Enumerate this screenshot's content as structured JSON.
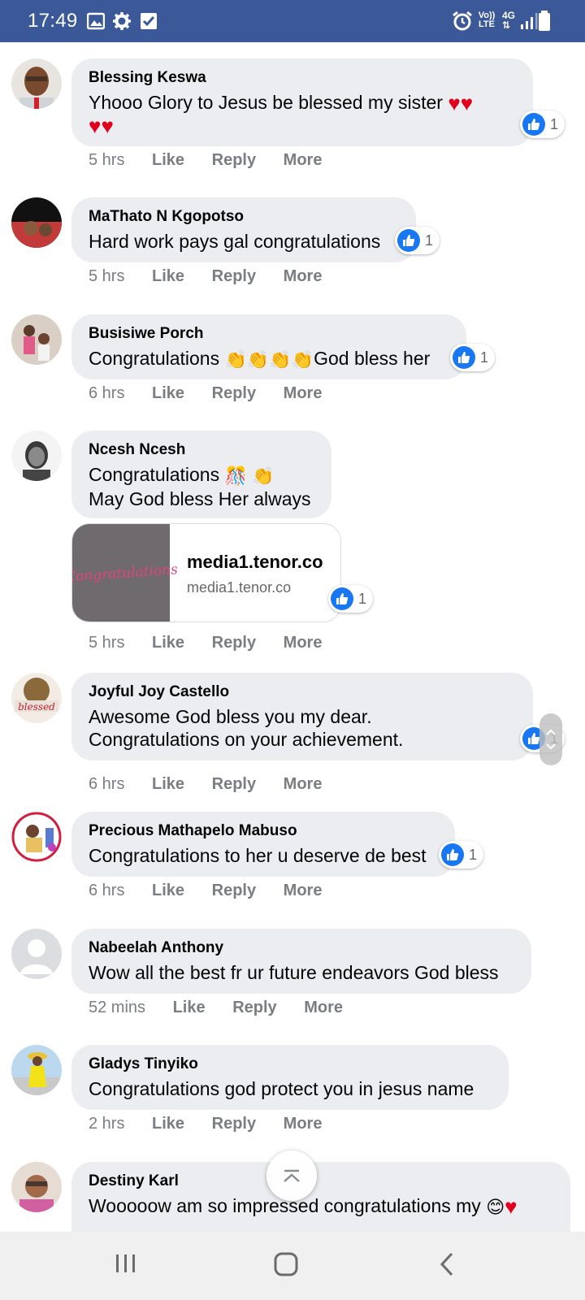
{
  "status_bar": {
    "time": "17:49",
    "left_icons": [
      "image-icon",
      "gear-icon",
      "checkbox-icon"
    ],
    "right_icons": [
      "alarm-icon",
      "volte-icon",
      "data-4g-icon",
      "signal-icon",
      "battery-icon"
    ],
    "volte_label": "Vo)) LTE",
    "network_label": "4G",
    "bg_color": "#3b5998"
  },
  "comments": [
    {
      "author": "Blessing Keswa",
      "lines": [
        "Yhooo Glory to Jesus be blessed my sister",
        ""
      ],
      "time": "5 hrs",
      "like": "Like",
      "reply": "Reply",
      "more": "More",
      "reactions": "1"
    },
    {
      "author": "MaThato N Kgopotso",
      "lines": [
        "Hard work pays gal congratulations"
      ],
      "time": "5 hrs",
      "like": "Like",
      "reply": "Reply",
      "more": "More",
      "reactions": "1"
    },
    {
      "author": "Busisiwe Porch",
      "text_before": "Congratulations",
      "text_after": "God bless her",
      "time": "6 hrs",
      "like": "Like",
      "reply": "Reply",
      "more": "More",
      "reactions": "1"
    },
    {
      "author": "Ncesh Ncesh",
      "lines": [
        "Congratulations",
        "May God bless Her always"
      ],
      "link": {
        "domain": "media1.tenor.co",
        "subtitle": "media1.tenor.co",
        "thumb_text": "Congratulations"
      },
      "time": "5 hrs",
      "like": "Like",
      "reply": "Reply",
      "more": "More",
      "reactions": "1"
    },
    {
      "author": "Joyful Joy Castello",
      "lines": [
        "Awesome God bless you my dear.",
        "Congratulations on your achievement."
      ],
      "time": "6 hrs",
      "like": "Like",
      "reply": "Reply",
      "more": "More",
      "reactions": "1"
    },
    {
      "author": "Precious Mathapelo Mabuso",
      "lines": [
        "Congratulations to her u deserve de best"
      ],
      "time": "6 hrs",
      "like": "Like",
      "reply": "Reply",
      "more": "More",
      "reactions": "1"
    },
    {
      "author": "Nabeelah Anthony",
      "lines": [
        "Wow all the best fr ur future endeavors God bless"
      ],
      "time": "52 mins",
      "like": "Like",
      "reply": "Reply",
      "more": "More"
    },
    {
      "author": "Gladys Tinyiko",
      "lines": [
        "Congratulations god protect you in jesus name"
      ],
      "time": "2 hrs",
      "like": "Like",
      "reply": "Reply",
      "more": "More"
    },
    {
      "author": "Destiny Karl",
      "lines": [
        "Wooooow am so impressed congratulations my"
      ]
    }
  ],
  "colors": {
    "bubble": "#ebedf0",
    "like_blue": "#1877f2",
    "heart_red": "#e0001b",
    "meta_gray": "#7a7d82"
  },
  "nav_bar": {
    "icons": [
      "recent-apps-icon",
      "home-icon",
      "back-icon"
    ]
  }
}
